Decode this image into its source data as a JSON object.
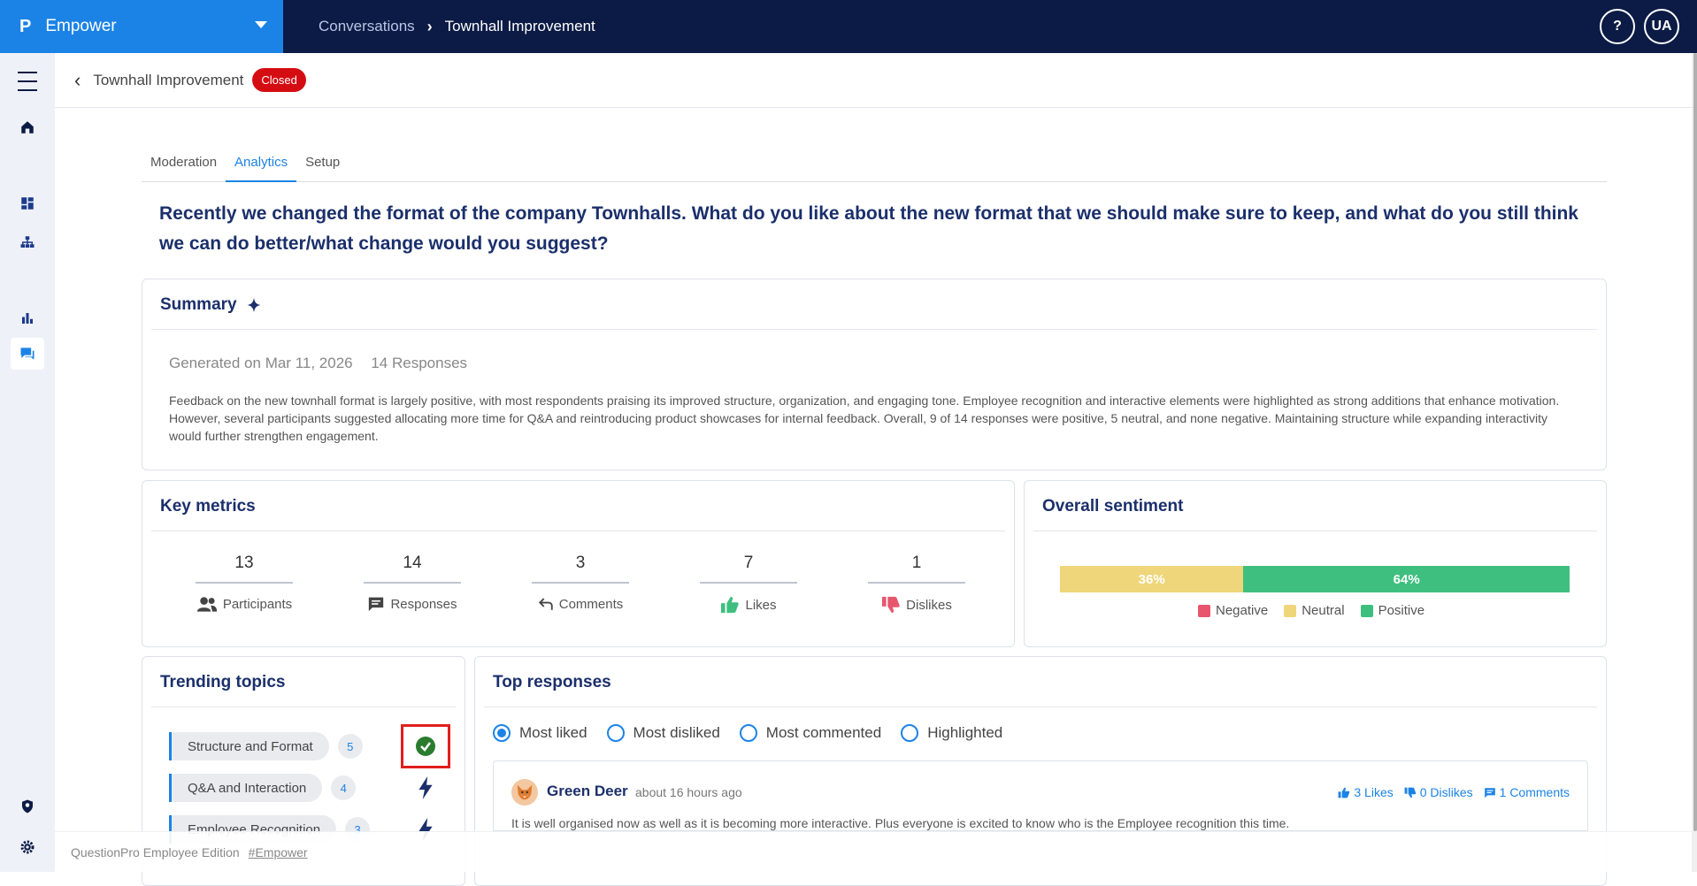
{
  "app": {
    "name": "Empower",
    "logo_glyph": "P"
  },
  "breadcrumb": {
    "parent": "Conversations",
    "current": "Townhall Improvement"
  },
  "topbar": {
    "help_label": "?",
    "user_initials": "UA"
  },
  "page": {
    "title": "Townhall Improvement",
    "status": "Closed"
  },
  "tabs": [
    "Moderation",
    "Analytics",
    "Setup"
  ],
  "question": "Recently we changed the format of the company Townhalls. What do you like about the new format that we should make sure to keep, and what do you still think we can do better/what change would you suggest?",
  "summary": {
    "title": "Summary",
    "generated": "Generated on Mar 11, 2026",
    "responses": "14 Responses",
    "text": "Feedback on the new townhall format is largely positive, with most respondents praising its improved structure, organization, and engaging tone. Employee recognition and interactive elements were highlighted as strong additions that enhance motivation. However, several participants suggested allocating more time for Q&A and reintroducing product showcases for internal feedback. Overall, 9 of 14 responses were positive, 5 neutral, and none negative. Maintaining structure while expanding interactivity would further strengthen engagement."
  },
  "key_metrics": {
    "title": "Key metrics",
    "items": [
      {
        "value": "13",
        "label": "Participants",
        "icon": "people-icon"
      },
      {
        "value": "14",
        "label": "Responses",
        "icon": "chat-icon"
      },
      {
        "value": "3",
        "label": "Comments",
        "icon": "reply-icon"
      },
      {
        "value": "7",
        "label": "Likes",
        "icon": "thumb-up-icon"
      },
      {
        "value": "1",
        "label": "Dislikes",
        "icon": "thumb-down-icon"
      }
    ]
  },
  "sentiment": {
    "title": "Overall sentiment",
    "neutral_pct": "36%",
    "positive_pct": "64%",
    "legend": [
      "Negative",
      "Neutral",
      "Positive"
    ],
    "colors": {
      "negative": "#e8566d",
      "neutral": "#efd67a",
      "positive": "#3fbf7f"
    }
  },
  "trending": {
    "title": "Trending topics",
    "items": [
      {
        "label": "Structure and Format",
        "count": "5",
        "icon": "check-circle-icon"
      },
      {
        "label": "Q&A and Interaction",
        "count": "4",
        "icon": "bolt-icon"
      },
      {
        "label": "Employee Recognition",
        "count": "3",
        "icon": "bolt-icon"
      }
    ]
  },
  "top_responses": {
    "title": "Top responses",
    "filters": [
      "Most liked",
      "Most disliked",
      "Most commented",
      "Highlighted"
    ],
    "selected": "Most liked",
    "first": {
      "author": "Green Deer",
      "time": "about 16 hours ago",
      "likes": "3 Likes",
      "dislikes": "0 Dislikes",
      "comments": "1 Comments",
      "text": "It is well organised now as well as it is becoming more interactive. Plus everyone is excited to know who is the Employee recognition this time."
    }
  },
  "footer": {
    "text": "QuestionPro Employee Edition",
    "link": "#Empower"
  },
  "colors": {
    "primary": "#1c83e6",
    "navy": "#0b1b45",
    "heading": "#1b2f6b",
    "closed": "#d40d12"
  }
}
